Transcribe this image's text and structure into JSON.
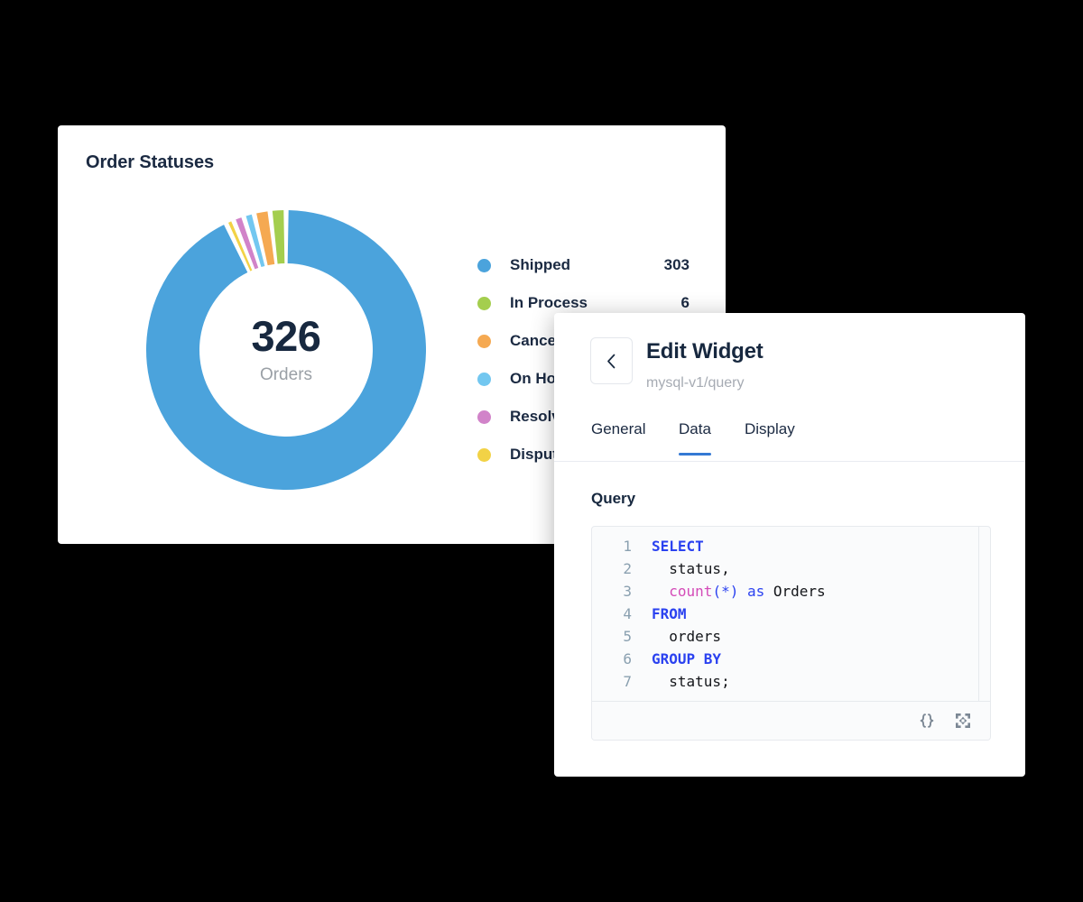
{
  "background_color": "#000000",
  "chart_card": {
    "title": "Order Statuses",
    "center_value": "326",
    "center_label": "Orders"
  },
  "chart_data": {
    "type": "pie",
    "variant": "donut",
    "title": "Order Statuses",
    "center_value": 326,
    "center_label": "Orders",
    "total": 326,
    "categories": [
      "Shipped",
      "In Process",
      "Cancelled",
      "On Hold",
      "Resolved",
      "Disputed"
    ],
    "values": [
      303,
      6,
      6,
      4,
      4,
      3
    ],
    "labels_shown": [
      "303",
      "6",
      "",
      "",
      "",
      ""
    ],
    "colors": [
      "#4BA3DC",
      "#A4CE4E",
      "#F5A952",
      "#72C7F0",
      "#D183C9",
      "#F2D246"
    ],
    "legend_position": "right",
    "grid": false,
    "series": [
      {
        "name": "Orders",
        "values": [
          303,
          6,
          6,
          4,
          4,
          3
        ]
      }
    ]
  },
  "legend": {
    "items": [
      {
        "label": "Shipped",
        "value": "303",
        "color": "#4BA3DC"
      },
      {
        "label": "In Process",
        "value": "6",
        "color": "#A4CE4E"
      },
      {
        "label": "Cancelled",
        "value": "",
        "color": "#F5A952"
      },
      {
        "label": "On Hold",
        "value": "",
        "color": "#72C7F0"
      },
      {
        "label": "Resolved",
        "value": "",
        "color": "#D183C9"
      },
      {
        "label": "Disputed",
        "value": "",
        "color": "#F2D246"
      }
    ]
  },
  "panel": {
    "title": "Edit Widget",
    "subtitle": "mysql-v1/query",
    "back_icon": "chevron-left-icon",
    "tabs": [
      {
        "label": "General",
        "active": false
      },
      {
        "label": "Data",
        "active": true
      },
      {
        "label": "Display",
        "active": false
      }
    ],
    "active_tab_color": "#3479d4",
    "query_section_label": "Query",
    "editor": {
      "lines": [
        {
          "num": "1",
          "tokens": [
            {
              "t": "SELECT",
              "c": "kw"
            }
          ]
        },
        {
          "num": "2",
          "tokens": [
            {
              "t": "  status,",
              "c": "id"
            }
          ]
        },
        {
          "num": "3",
          "tokens": [
            {
              "t": "  ",
              "c": "id"
            },
            {
              "t": "count",
              "c": "fn"
            },
            {
              "t": "(*)",
              "c": "op"
            },
            {
              "t": " ",
              "c": "id"
            },
            {
              "t": "as",
              "c": "as"
            },
            {
              "t": " Orders",
              "c": "id"
            }
          ]
        },
        {
          "num": "4",
          "tokens": [
            {
              "t": "FROM",
              "c": "kw"
            }
          ]
        },
        {
          "num": "5",
          "tokens": [
            {
              "t": "  orders",
              "c": "id"
            }
          ]
        },
        {
          "num": "6",
          "tokens": [
            {
              "t": "GROUP BY",
              "c": "kw"
            }
          ]
        },
        {
          "num": "7",
          "tokens": [
            {
              "t": "  status;",
              "c": "id"
            }
          ]
        }
      ],
      "footer_icons": [
        "format-braces-icon",
        "fullscreen-expand-icon"
      ]
    }
  }
}
